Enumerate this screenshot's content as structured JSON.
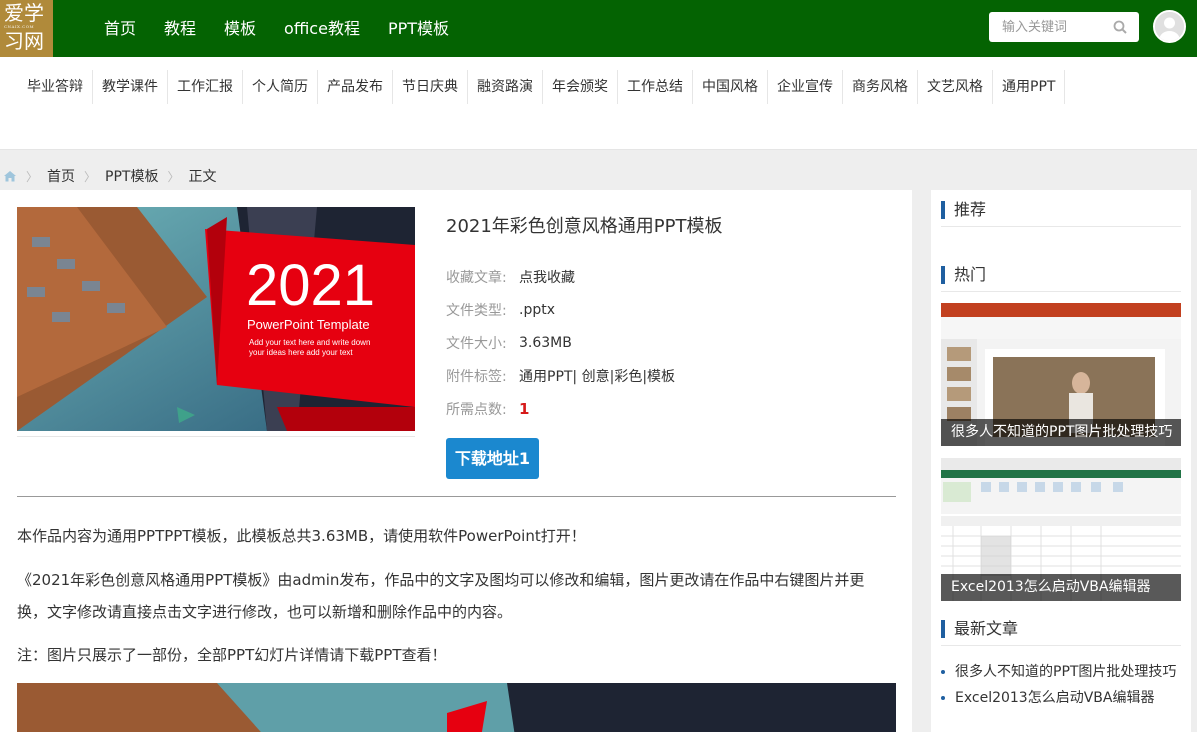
{
  "header": {
    "logo_top": "爱学",
    "logo_sub": "CNAIX.COM",
    "logo_bottom": "习网",
    "nav": [
      "首页",
      "教程",
      "模板",
      "office教程",
      "PPT模板"
    ],
    "search_placeholder": "输入关键词",
    "search_icon": "search-icon",
    "avatar_icon": "user-avatar-icon",
    "color": "#046302"
  },
  "categories": [
    "毕业答辩",
    "教学课件",
    "工作汇报",
    "个人简历",
    "产品发布",
    "节日庆典",
    "融资路演",
    "年会颁奖",
    "工作总结",
    "中国风格",
    "企业宣传",
    "商务风格",
    "文艺风格",
    "通用PPT"
  ],
  "breadcrumb": {
    "home_icon": "home-icon",
    "items": [
      "首页",
      "PPT模板",
      "正文"
    ]
  },
  "article": {
    "cover": {
      "year": "2021",
      "subtitle": "PowerPoint Template",
      "line1": "Add your text here and write down",
      "line2": "your ideas  here add your text"
    },
    "title": "2021年彩色创意风格通用PPT模板",
    "meta": [
      {
        "key": "收藏文章:",
        "value": "点我收藏"
      },
      {
        "key": "文件类型:",
        "value": ".pptx"
      },
      {
        "key": "文件大小:",
        "value": "3.63MB"
      },
      {
        "key": "附件标签:",
        "value": "通用PPT| 创意|彩色|模板"
      },
      {
        "key": "所需点数:",
        "value": "1"
      }
    ],
    "download_label": "下载地址1",
    "paragraphs": [
      "本作品内容为通用PPTPPT模板，此模板总共3.63MB，请使用软件PowerPoint打开！",
      "《2021年彩色创意风格通用PPT模板》由admin发布，作品中的文字及图均可以修改和编辑，图片更改请在作品中右键图片并更换，文字修改请直接点击文字进行修改，也可以新增和删除作品中的内容。",
      "注：图片只展示了一部份，全部PPT幻灯片详情请下载PPT查看！"
    ],
    "accent": "#1b88cf"
  },
  "sidebar": {
    "recommend_title": "推荐",
    "hot_title": "热门",
    "hot": [
      {
        "caption": "很多人不知道的PPT图片批处理技巧"
      },
      {
        "caption": "Excel2013怎么启动VBA编辑器"
      }
    ],
    "latest_title": "最新文章",
    "latest": [
      "很多人不知道的PPT图片批处理技巧",
      "Excel2013怎么启动VBA编辑器"
    ]
  }
}
